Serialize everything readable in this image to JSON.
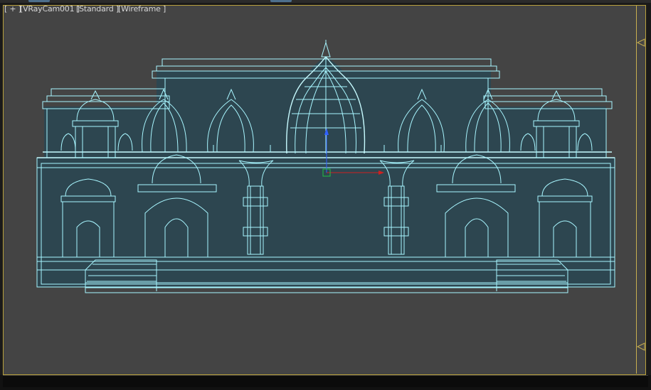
{
  "viewport": {
    "labels": {
      "plus": "[ + ]",
      "camera": "[VRayCam001 ]",
      "shading": "[Standard ]",
      "mode": "[Wireframe ]"
    }
  },
  "colors": {
    "viewport_bg": "#444444",
    "wire": "#a8f6ff",
    "frame": "#c9b050",
    "gizmo_x": "#d02020",
    "gizmo_y": "#3060ff",
    "gizmo_center": "#20c040"
  },
  "icons": [
    "frame-marker-top-icon",
    "frame-marker-bottom-icon",
    "transform-gizmo-icon"
  ]
}
